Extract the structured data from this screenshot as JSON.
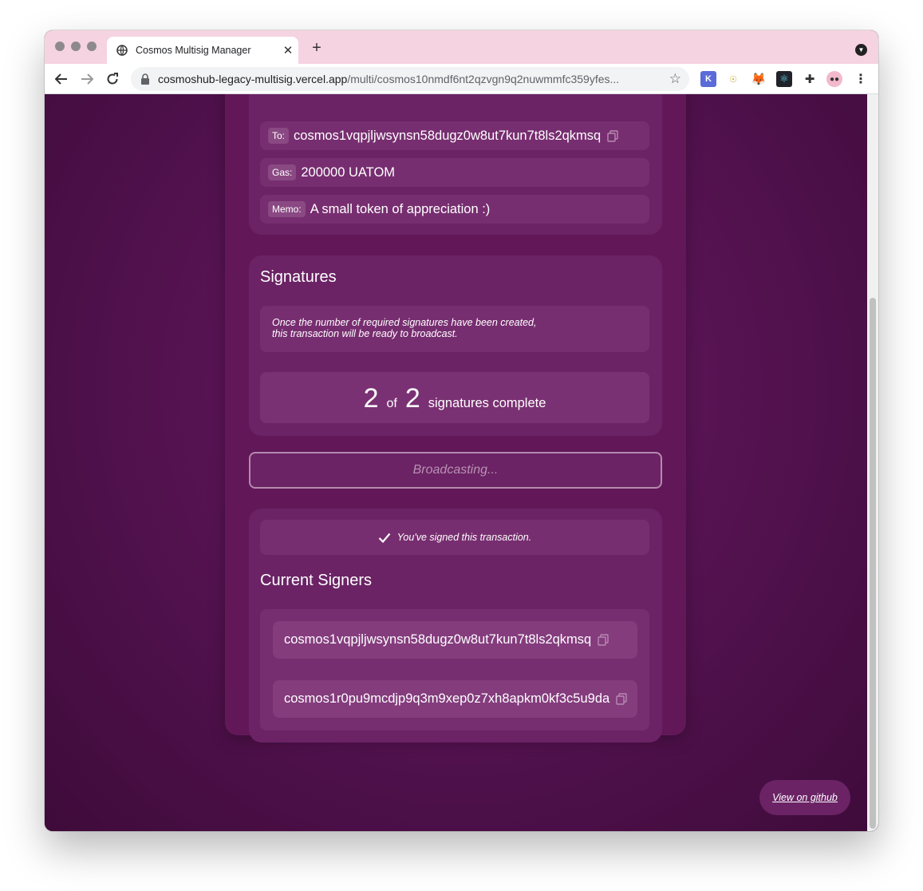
{
  "browser": {
    "tab_title": "Cosmos Multisig Manager",
    "url_host": "cosmoshub-legacy-multisig.vercel.app",
    "url_path": "/multi/cosmos10nmdf6nt2qzvgn9q2nuwmmfc359yfes..."
  },
  "details": {
    "to_label": "To:",
    "to_value": "cosmos1vqpjljwsynsn58dugz0w8ut7kun7t8ls2qkmsq",
    "gas_label": "Gas:",
    "gas_value": "200000 UATOM",
    "memo_label": "Memo:",
    "memo_value": "A small token of appreciation :)"
  },
  "signatures": {
    "title": "Signatures",
    "note_line1": "Once the number of required signatures have been created,",
    "note_line2": "this transaction will be ready to broadcast.",
    "current": "2",
    "of_label": "of",
    "required": "2",
    "complete_label": "signatures complete"
  },
  "broadcast_label": "Broadcasting...",
  "signers": {
    "signed_message": "You've signed this transaction.",
    "title": "Current Signers",
    "list": [
      "cosmos1vqpjljwsynsn58dugz0w8ut7kun7t8ls2qkmsq",
      "cosmos1r0pu9mcdjp9q3m9xep0z7xh8apkm0kf3c5u9da"
    ]
  },
  "github_link": "View on github",
  "colors": {
    "background": "#561352",
    "card": "#621858",
    "section": "#6b2365",
    "row": "#772e70",
    "tabstrip": "#f6d3e1"
  }
}
